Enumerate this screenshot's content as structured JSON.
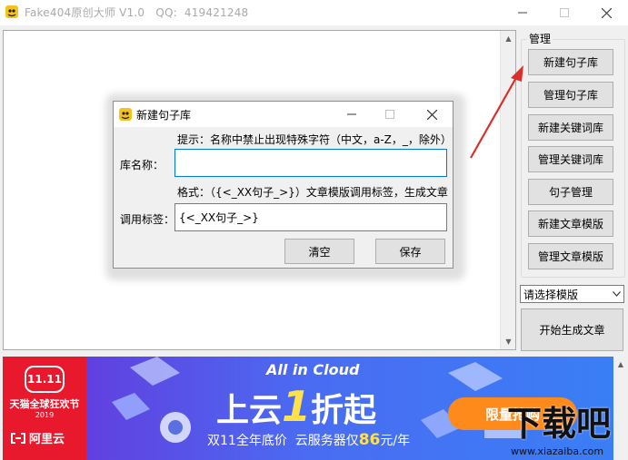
{
  "window": {
    "title": "Fake404原创大师 V1.0   QQ:  419421248"
  },
  "panel": {
    "group_label": "管理",
    "buttons": [
      "新建句子库",
      "管理句子库",
      "新建关键词库",
      "管理关键词库",
      "句子管理",
      "新建文章模版",
      "管理文章模版"
    ],
    "template_select": "请选择模版",
    "generate_label": "开始生成文章"
  },
  "dialog": {
    "title": "新建句子库",
    "hint": "提示：名称中禁止出现特殊字符（中文，a-Z，_，除外）",
    "name_label": "库名称：",
    "name_value": "",
    "format": "格式：（{<_XX句子_>}）文章模版调用标签，生成文章",
    "tag_label": "调用标签：",
    "tag_value": "{<_XX句子_>}",
    "clear_label": "清空",
    "save_label": "保存"
  },
  "banner": {
    "tmall_top": "11.11",
    "tmall_line1": "天猫全球狂欢节",
    "tmall_year": "2019",
    "aliyun": "阿里云",
    "headline_en": "All in Cloud",
    "headline_cn_a": "上云",
    "headline_cn_b": "1",
    "headline_cn_c": "折起",
    "subline_a": "双11全年底价  云服务器仅",
    "subline_price": "86",
    "subline_b": "元/年",
    "cta": "限量抢购"
  },
  "watermark": {
    "cn": "下载吧",
    "url": "www.xiazaiba.com"
  },
  "colors": {
    "accent": "#0078d7",
    "arrow": "#d9302a",
    "banner_purple": "#6a2fd8",
    "tmall_red": "#e8192c",
    "cta_orange": "#ff8a1c"
  }
}
